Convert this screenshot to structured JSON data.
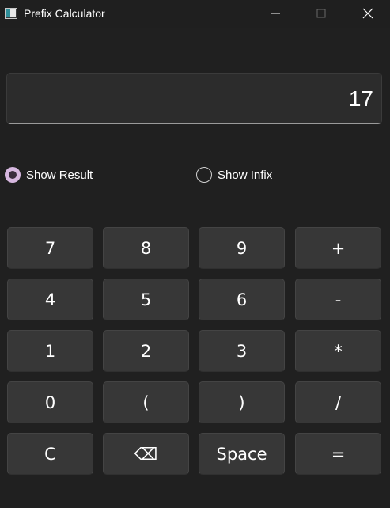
{
  "window": {
    "title": "Prefix Calculator",
    "controls": [
      "minimize",
      "maximize",
      "close"
    ]
  },
  "display": {
    "value": "17"
  },
  "options": {
    "show_result": {
      "label": "Show Result",
      "checked": true
    },
    "show_infix": {
      "label": "Show Infix",
      "checked": false
    }
  },
  "keypad": {
    "rows": [
      [
        "7",
        "8",
        "9",
        "+"
      ],
      [
        "4",
        "5",
        "6",
        "-"
      ],
      [
        "1",
        "2",
        "3",
        "*"
      ],
      [
        "0",
        "(",
        ")",
        "/"
      ],
      [
        "C",
        "⌫",
        "Space",
        "="
      ]
    ]
  },
  "colors": {
    "background": "#202020",
    "key": "#373737",
    "radio_accent": "#d7b8e0"
  }
}
